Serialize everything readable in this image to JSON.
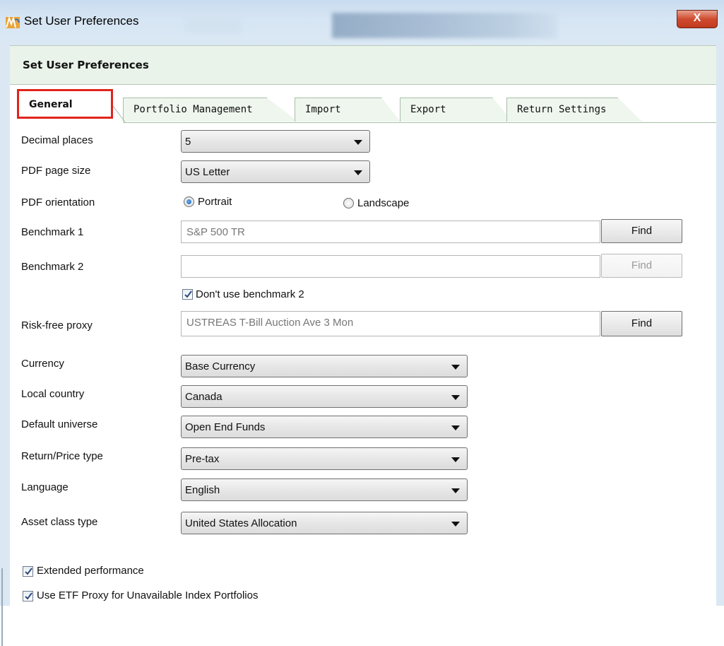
{
  "window": {
    "title": "Set User Preferences",
    "close_label": "X"
  },
  "dialog": {
    "header": "Set User Preferences"
  },
  "tabs": [
    {
      "label": "General",
      "selected": true
    },
    {
      "label": "Portfolio Management"
    },
    {
      "label": "Import"
    },
    {
      "label": "Export"
    },
    {
      "label": "Return Settings"
    }
  ],
  "form": {
    "decimal_places": {
      "label": "Decimal places",
      "value": "5"
    },
    "pdf_page_size": {
      "label": "PDF page size",
      "value": "US Letter"
    },
    "pdf_orientation": {
      "label": "PDF orientation",
      "options": [
        "Portrait",
        "Landscape"
      ],
      "selected": "Portrait"
    },
    "benchmark1": {
      "label": "Benchmark 1",
      "value": "S&P 500 TR",
      "button": "Find"
    },
    "benchmark2": {
      "label": "Benchmark 2",
      "value": "",
      "button": "Find"
    },
    "dont_use_benchmark2": {
      "label": "Don't use benchmark 2",
      "checked": true
    },
    "risk_free_proxy": {
      "label": "Risk-free proxy",
      "value": "USTREAS T-Bill Auction Ave 3 Mon",
      "button": "Find"
    },
    "currency": {
      "label": "Currency",
      "value": "Base Currency"
    },
    "local_country": {
      "label": "Local country",
      "value": "Canada"
    },
    "default_universe": {
      "label": "Default universe",
      "value": "Open End Funds"
    },
    "return_price_type": {
      "label": "Return/Price type",
      "value": "Pre-tax"
    },
    "language": {
      "label": "Language",
      "value": "English"
    },
    "asset_class_type": {
      "label": "Asset class type",
      "value": "United States Allocation"
    },
    "extended_performance": {
      "label": "Extended performance",
      "checked": true
    },
    "use_etf_proxy": {
      "label": "Use ETF Proxy for Unavailable Index Portfolios",
      "checked": true
    }
  },
  "colors": {
    "highlight": "#e0241b",
    "header_bg": "#eaf3ea"
  }
}
